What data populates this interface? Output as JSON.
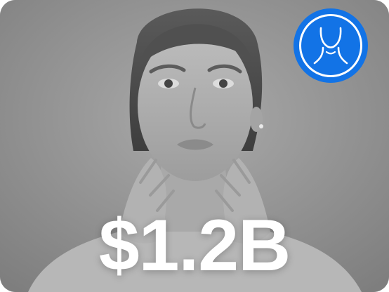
{
  "card": {
    "stat_value": "$1.2B",
    "badge_icon": "neck-jawline-icon",
    "badge_color": "#1273e6",
    "photo_subject": "woman-portrait-image"
  }
}
